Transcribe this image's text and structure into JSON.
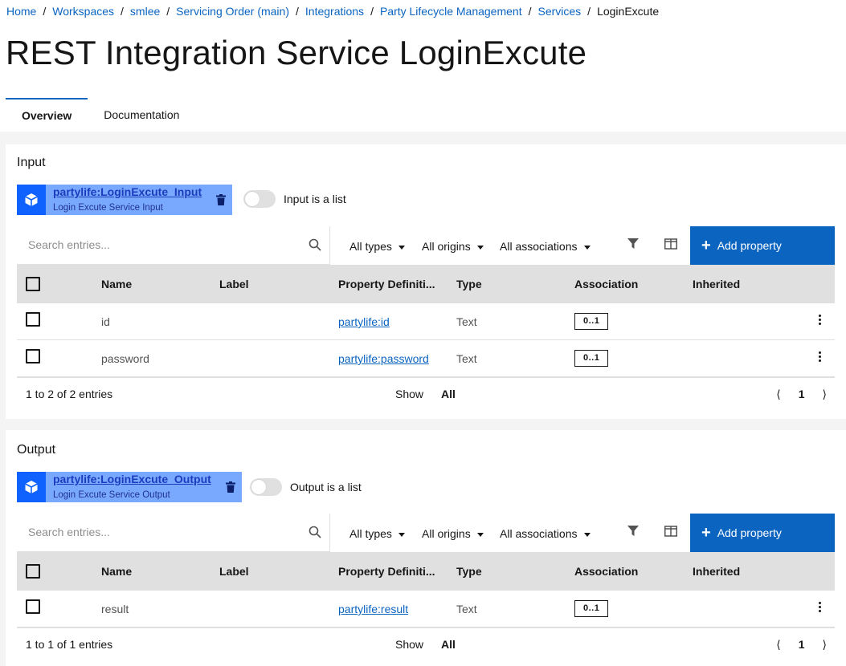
{
  "breadcrumb": [
    "Home",
    "Workspaces",
    "smlee",
    "Servicing Order (main)",
    "Integrations",
    "Party Lifecycle Management",
    "Services",
    "LoginExcute"
  ],
  "page": {
    "title_prefix": "REST Integration Service",
    "title_name": "LoginExcute"
  },
  "tabs": [
    {
      "label": "Overview",
      "active": true
    },
    {
      "label": "Documentation",
      "active": false
    }
  ],
  "input": {
    "heading": "Input",
    "type_link": "partylife:LoginExcute_Input",
    "type_desc": "Login Excute Service Input",
    "list_toggle_label": "Input is a list",
    "search_placeholder": "Search entries...",
    "filters": [
      "All types",
      "All origins",
      "All associations"
    ],
    "add_label": "Add property",
    "columns": [
      "Name",
      "Label",
      "Property Definiti...",
      "Type",
      "Association",
      "Inherited"
    ],
    "rows": [
      {
        "name": "id",
        "label": "",
        "definition": "partylife:id",
        "type": "Text",
        "association": "0..1"
      },
      {
        "name": "password",
        "label": "",
        "definition": "partylife:password",
        "type": "Text",
        "association": "0..1"
      }
    ],
    "footer": {
      "range": "1 to 2 of 2 entries",
      "show_label": "Show",
      "show_value": "All",
      "page": "1"
    }
  },
  "output": {
    "heading": "Output",
    "type_link": "partylife:LoginExcute_Output",
    "type_desc": "Login Excute Service Output",
    "list_toggle_label": "Output is a list",
    "search_placeholder": "Search entries...",
    "filters": [
      "All types",
      "All origins",
      "All associations"
    ],
    "add_label": "Add property",
    "columns": [
      "Name",
      "Label",
      "Property Definiti...",
      "Type",
      "Association",
      "Inherited"
    ],
    "rows": [
      {
        "name": "result",
        "label": "",
        "definition": "partylife:result",
        "type": "Text",
        "association": "0..1"
      }
    ],
    "footer": {
      "range": "1 to 1 of 1 entries",
      "show_label": "Show",
      "show_value": "All",
      "page": "1"
    }
  },
  "colors": {
    "link": "#0b64c0",
    "tag_bg": "#78a9ff",
    "tag_icon_bg": "#0f62fe",
    "primary_button": "#0b64c0"
  }
}
